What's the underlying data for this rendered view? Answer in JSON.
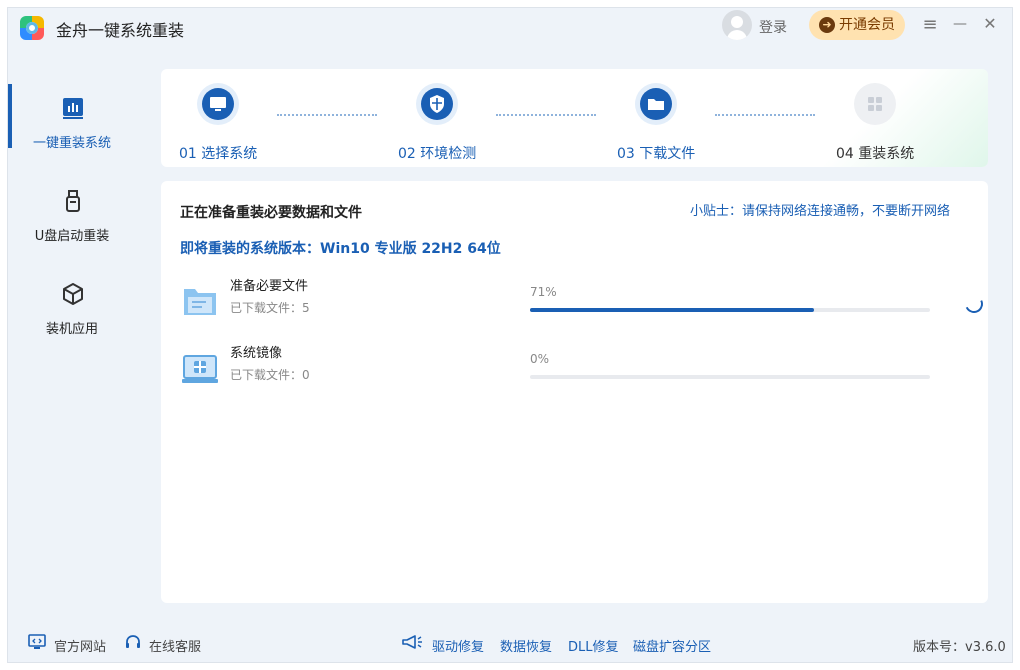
{
  "app": {
    "title": "金舟一键系统重装"
  },
  "header": {
    "login_label": "登录",
    "vip_label": "开通会员",
    "menu_icon": "≡",
    "minimize_icon": "—",
    "close_icon": "✕"
  },
  "sidebar": {
    "items": [
      {
        "label": "一键重装系统",
        "icon": "bar-chart-icon",
        "active": true
      },
      {
        "label": "U盘启动重装",
        "icon": "usb-drive-icon",
        "active": false
      },
      {
        "label": "装机应用",
        "icon": "cube-icon",
        "active": false
      }
    ]
  },
  "steps": [
    {
      "label": "01 选择系统",
      "icon": "monitor-icon",
      "state": "done"
    },
    {
      "label": "02 环境检测",
      "icon": "shield-icon",
      "state": "done"
    },
    {
      "label": "03 下载文件",
      "icon": "folder-icon",
      "state": "active"
    },
    {
      "label": "04 重装系统",
      "icon": "windows-icon",
      "state": "pending"
    }
  ],
  "main": {
    "heading": "正在准备重装必要数据和文件",
    "tip": "小贴士：请保持网络连接通畅，不要断开网络",
    "version_line": "即将重装的系统版本：Win10 专业版 22H2 64位",
    "items": [
      {
        "name": "准备必要文件",
        "sub": "已下载文件：5",
        "percent_label": "71%",
        "progress": 0.71,
        "icon": "folder-files-icon"
      },
      {
        "name": "系统镜像",
        "sub": "已下载文件：0",
        "percent_label": "0%",
        "progress": 0.0,
        "icon": "system-image-icon"
      }
    ]
  },
  "footer": {
    "website": "官方网站",
    "support": "在线客服",
    "driver_repair": "驱动修复",
    "data_recovery": "数据恢复",
    "dll_repair": "DLL修复",
    "disk_partition": "磁盘扩容分区",
    "version": "版本号：v3.6.0"
  },
  "colors": {
    "accent": "#1a5fb4",
    "background": "#eef3f9",
    "vip": "#ffe2b0"
  }
}
